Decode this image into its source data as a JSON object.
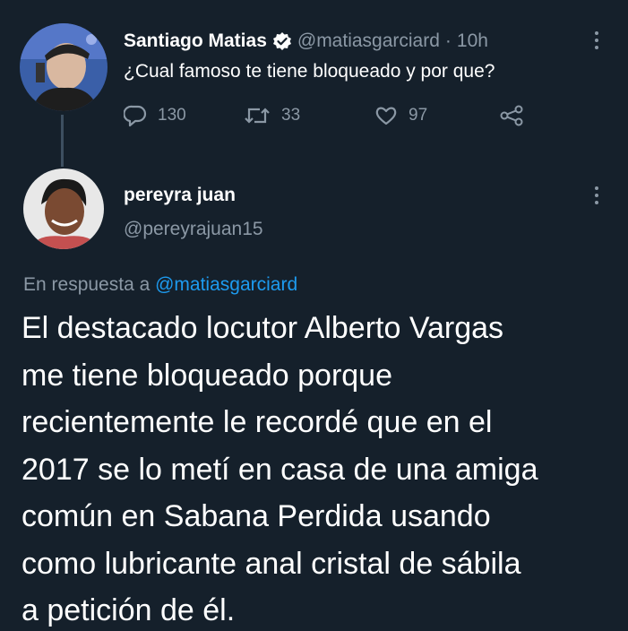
{
  "tweet": {
    "author_name": "Santiago Matias",
    "author_handle": "@matiasgarciard",
    "separator": "·",
    "time": "10h",
    "text": "¿Cual famoso te tiene bloqueado y por que?",
    "verified": true,
    "actions": {
      "reply_count": "130",
      "retweet_count": "33",
      "like_count": "97"
    }
  },
  "reply": {
    "author_name": "pereyra juan",
    "author_handle": "@pereyrajuan15",
    "reply_prefix": "En respuesta a",
    "reply_mention": "@matiasgarciard",
    "text_lines": [
      "El destacado locutor Alberto Vargas",
      "me tiene bloqueado porque",
      "recientemente le recordé que en el",
      "2017 se lo metí en casa de una amiga",
      "común en Sabana Perdida usando",
      "como lubricante anal cristal de sábila",
      "a petición de él."
    ]
  },
  "colors": {
    "background": "#15202b",
    "primary_text": "#ffffff",
    "secondary_text": "#8b98a5",
    "accent": "#1d9bf0"
  },
  "icons": [
    "avatar",
    "verified-badge-icon",
    "more-options-icon",
    "reply-icon",
    "retweet-icon",
    "like-icon",
    "share-icon"
  ]
}
